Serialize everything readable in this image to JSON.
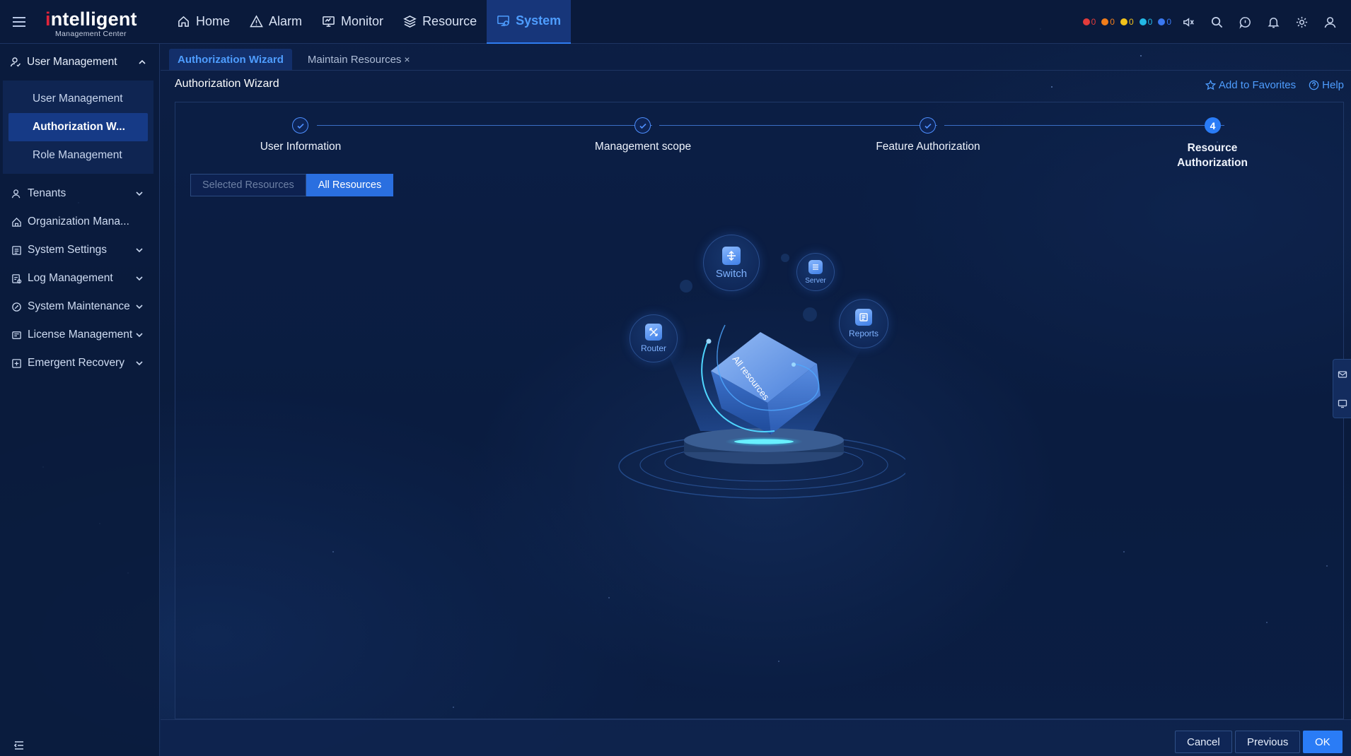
{
  "app": {
    "logo_main": "ntelligent",
    "logo_initial": "i",
    "logo_sub": "Management Center"
  },
  "nav": [
    {
      "label": "Home",
      "icon": "home-icon"
    },
    {
      "label": "Alarm",
      "icon": "alarm-icon"
    },
    {
      "label": "Monitor",
      "icon": "monitor-icon"
    },
    {
      "label": "Resource",
      "icon": "resource-icon"
    },
    {
      "label": "System",
      "icon": "system-icon",
      "active": true
    }
  ],
  "alarms": [
    {
      "count": "0",
      "color": "#e23b3b"
    },
    {
      "count": "0",
      "color": "#f07d1a"
    },
    {
      "count": "0",
      "color": "#f2c21b"
    },
    {
      "count": "0",
      "color": "#23b9e6"
    },
    {
      "count": "0",
      "color": "#3a78f0"
    }
  ],
  "sidebar": {
    "group_label": "User Management",
    "sub_items": [
      {
        "label": "User Management"
      },
      {
        "label": "Authorization W...",
        "active": true
      },
      {
        "label": "Role Management"
      }
    ],
    "items": [
      {
        "label": "Tenants"
      },
      {
        "label": "Organization Mana..."
      },
      {
        "label": "System Settings"
      },
      {
        "label": "Log Management"
      },
      {
        "label": "System Maintenance"
      },
      {
        "label": "License Management"
      },
      {
        "label": "Emergent Recovery"
      }
    ]
  },
  "tabs": [
    {
      "label": "Authorization Wizard",
      "active": true
    },
    {
      "label": "Maintain Resources",
      "close": "×"
    }
  ],
  "page": {
    "title": "Authorization Wizard",
    "favorites": "Add to Favorites",
    "help": "Help"
  },
  "stepper": {
    "steps": [
      {
        "label": "User Information",
        "state": "done"
      },
      {
        "label": "Management scope",
        "state": "done"
      },
      {
        "label": "Feature Authorization",
        "state": "done"
      },
      {
        "label": "Resource Authorization",
        "label_line1": "Resource",
        "label_line2": "Authorization",
        "state": "current",
        "number": "4"
      }
    ]
  },
  "segment": {
    "options": [
      "Selected Resources",
      "All Resources"
    ],
    "selected": "All Resources"
  },
  "illustration": {
    "cube_label": "All resources",
    "bubbles": [
      "Switch",
      "Server",
      "Router",
      "Reports"
    ]
  },
  "footer": {
    "cancel": "Cancel",
    "previous": "Previous",
    "ok": "OK"
  },
  "colors": {
    "accent": "#2a7cf6",
    "active_text": "#4e9dff",
    "background": "#0b1d3f"
  }
}
